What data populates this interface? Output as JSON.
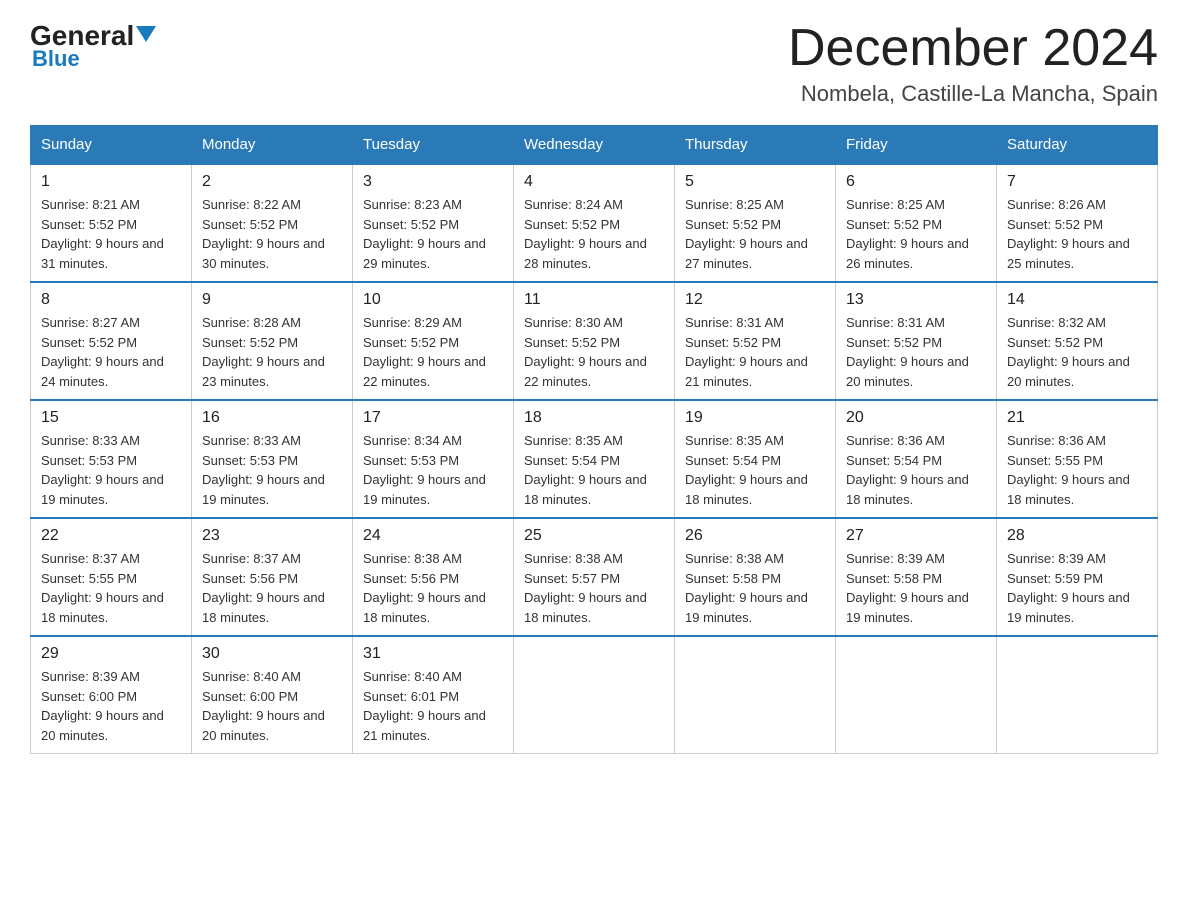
{
  "header": {
    "logo_general": "General",
    "logo_blue": "Blue",
    "month_title": "December 2024",
    "location": "Nombela, Castille-La Mancha, Spain"
  },
  "columns": [
    "Sunday",
    "Monday",
    "Tuesday",
    "Wednesday",
    "Thursday",
    "Friday",
    "Saturday"
  ],
  "weeks": [
    [
      {
        "day": "1",
        "sunrise": "8:21 AM",
        "sunset": "5:52 PM",
        "daylight": "9 hours and 31 minutes."
      },
      {
        "day": "2",
        "sunrise": "8:22 AM",
        "sunset": "5:52 PM",
        "daylight": "9 hours and 30 minutes."
      },
      {
        "day": "3",
        "sunrise": "8:23 AM",
        "sunset": "5:52 PM",
        "daylight": "9 hours and 29 minutes."
      },
      {
        "day": "4",
        "sunrise": "8:24 AM",
        "sunset": "5:52 PM",
        "daylight": "9 hours and 28 minutes."
      },
      {
        "day": "5",
        "sunrise": "8:25 AM",
        "sunset": "5:52 PM",
        "daylight": "9 hours and 27 minutes."
      },
      {
        "day": "6",
        "sunrise": "8:25 AM",
        "sunset": "5:52 PM",
        "daylight": "9 hours and 26 minutes."
      },
      {
        "day": "7",
        "sunrise": "8:26 AM",
        "sunset": "5:52 PM",
        "daylight": "9 hours and 25 minutes."
      }
    ],
    [
      {
        "day": "8",
        "sunrise": "8:27 AM",
        "sunset": "5:52 PM",
        "daylight": "9 hours and 24 minutes."
      },
      {
        "day": "9",
        "sunrise": "8:28 AM",
        "sunset": "5:52 PM",
        "daylight": "9 hours and 23 minutes."
      },
      {
        "day": "10",
        "sunrise": "8:29 AM",
        "sunset": "5:52 PM",
        "daylight": "9 hours and 22 minutes."
      },
      {
        "day": "11",
        "sunrise": "8:30 AM",
        "sunset": "5:52 PM",
        "daylight": "9 hours and 22 minutes."
      },
      {
        "day": "12",
        "sunrise": "8:31 AM",
        "sunset": "5:52 PM",
        "daylight": "9 hours and 21 minutes."
      },
      {
        "day": "13",
        "sunrise": "8:31 AM",
        "sunset": "5:52 PM",
        "daylight": "9 hours and 20 minutes."
      },
      {
        "day": "14",
        "sunrise": "8:32 AM",
        "sunset": "5:52 PM",
        "daylight": "9 hours and 20 minutes."
      }
    ],
    [
      {
        "day": "15",
        "sunrise": "8:33 AM",
        "sunset": "5:53 PM",
        "daylight": "9 hours and 19 minutes."
      },
      {
        "day": "16",
        "sunrise": "8:33 AM",
        "sunset": "5:53 PM",
        "daylight": "9 hours and 19 minutes."
      },
      {
        "day": "17",
        "sunrise": "8:34 AM",
        "sunset": "5:53 PM",
        "daylight": "9 hours and 19 minutes."
      },
      {
        "day": "18",
        "sunrise": "8:35 AM",
        "sunset": "5:54 PM",
        "daylight": "9 hours and 18 minutes."
      },
      {
        "day": "19",
        "sunrise": "8:35 AM",
        "sunset": "5:54 PM",
        "daylight": "9 hours and 18 minutes."
      },
      {
        "day": "20",
        "sunrise": "8:36 AM",
        "sunset": "5:54 PM",
        "daylight": "9 hours and 18 minutes."
      },
      {
        "day": "21",
        "sunrise": "8:36 AM",
        "sunset": "5:55 PM",
        "daylight": "9 hours and 18 minutes."
      }
    ],
    [
      {
        "day": "22",
        "sunrise": "8:37 AM",
        "sunset": "5:55 PM",
        "daylight": "9 hours and 18 minutes."
      },
      {
        "day": "23",
        "sunrise": "8:37 AM",
        "sunset": "5:56 PM",
        "daylight": "9 hours and 18 minutes."
      },
      {
        "day": "24",
        "sunrise": "8:38 AM",
        "sunset": "5:56 PM",
        "daylight": "9 hours and 18 minutes."
      },
      {
        "day": "25",
        "sunrise": "8:38 AM",
        "sunset": "5:57 PM",
        "daylight": "9 hours and 18 minutes."
      },
      {
        "day": "26",
        "sunrise": "8:38 AM",
        "sunset": "5:58 PM",
        "daylight": "9 hours and 19 minutes."
      },
      {
        "day": "27",
        "sunrise": "8:39 AM",
        "sunset": "5:58 PM",
        "daylight": "9 hours and 19 minutes."
      },
      {
        "day": "28",
        "sunrise": "8:39 AM",
        "sunset": "5:59 PM",
        "daylight": "9 hours and 19 minutes."
      }
    ],
    [
      {
        "day": "29",
        "sunrise": "8:39 AM",
        "sunset": "6:00 PM",
        "daylight": "9 hours and 20 minutes."
      },
      {
        "day": "30",
        "sunrise": "8:40 AM",
        "sunset": "6:00 PM",
        "daylight": "9 hours and 20 minutes."
      },
      {
        "day": "31",
        "sunrise": "8:40 AM",
        "sunset": "6:01 PM",
        "daylight": "9 hours and 21 minutes."
      },
      null,
      null,
      null,
      null
    ]
  ]
}
